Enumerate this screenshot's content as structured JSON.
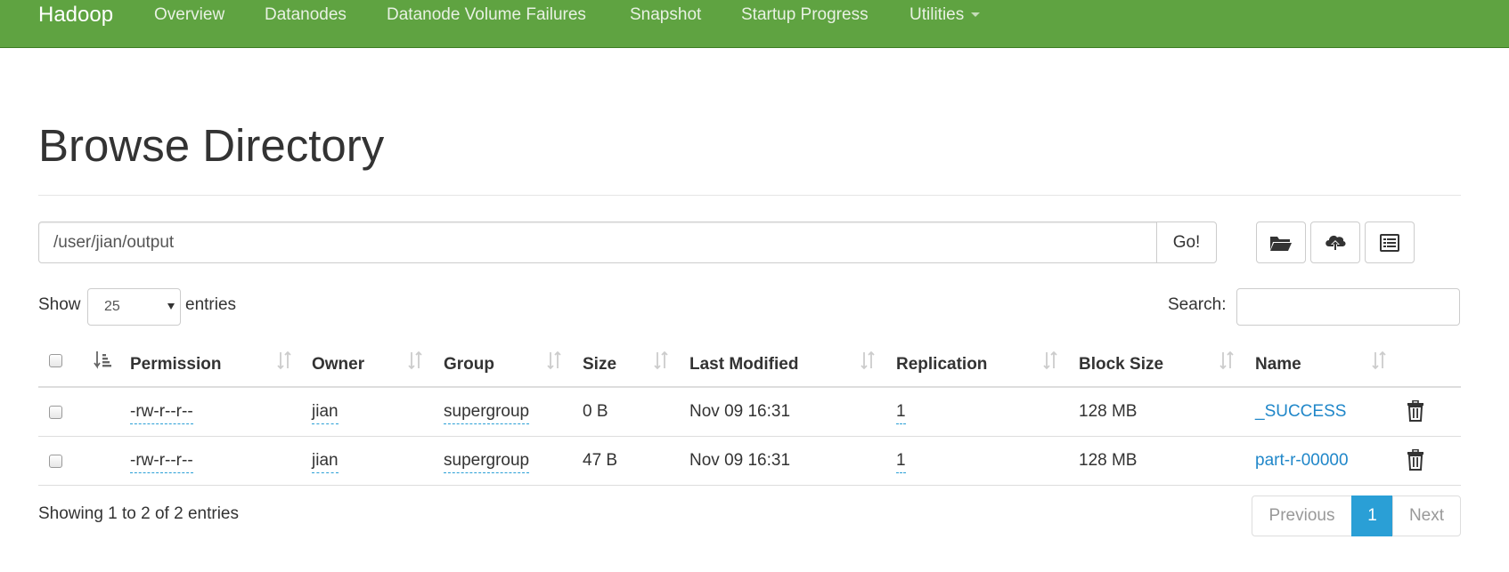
{
  "navbar": {
    "brand": "Hadoop",
    "items": [
      {
        "label": "Overview"
      },
      {
        "label": "Datanodes"
      },
      {
        "label": "Datanode Volume Failures"
      },
      {
        "label": "Snapshot"
      },
      {
        "label": "Startup Progress"
      },
      {
        "label": "Utilities"
      }
    ]
  },
  "page": {
    "title": "Browse Directory"
  },
  "path_bar": {
    "value": "/user/jian/output",
    "go_label": "Go!",
    "tools": [
      "folder-open-icon",
      "cloud-upload-icon",
      "list-alt-icon"
    ]
  },
  "controls": {
    "show_label": "Show",
    "page_length": "25",
    "entries_label": "entries",
    "search_label": "Search:",
    "search_value": ""
  },
  "table": {
    "columns": [
      "Permission",
      "Owner",
      "Group",
      "Size",
      "Last Modified",
      "Replication",
      "Block Size",
      "Name"
    ],
    "rows": [
      {
        "permission": "-rw-r--r--",
        "owner": "jian",
        "group": "supergroup",
        "size": "0 B",
        "last_modified": "Nov 09 16:31",
        "replication": "1",
        "block_size": "128 MB",
        "name": "_SUCCESS"
      },
      {
        "permission": "-rw-r--r--",
        "owner": "jian",
        "group": "supergroup",
        "size": "47 B",
        "last_modified": "Nov 09 16:31",
        "replication": "1",
        "block_size": "128 MB",
        "name": "part-r-00000"
      }
    ]
  },
  "footer": {
    "info": "Showing 1 to 2 of 2 entries",
    "previous": "Previous",
    "current_page": "1",
    "next": "Next"
  },
  "colors": {
    "navbar": "#5fa341",
    "link": "#2087c9",
    "active_page": "#2a9fd6"
  }
}
